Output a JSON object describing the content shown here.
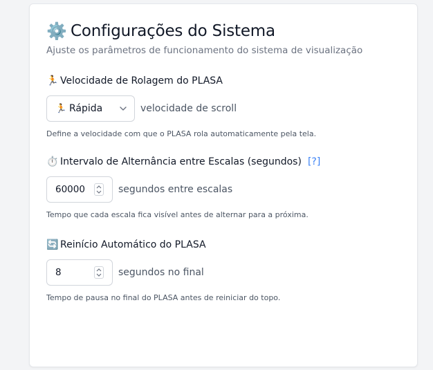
{
  "header": {
    "icon": "gear-icon",
    "icon_glyph": "⚙️",
    "title": "Configurações do Sistema",
    "subtitle": "Ajuste os parâmetros de funcionamento do sistema de visualização"
  },
  "scroll_speed": {
    "icon": "runner-icon",
    "icon_glyph": "🏃",
    "label": "Velocidade de Rolagem do PLASA",
    "selected_icon_glyph": "🏃",
    "selected_value": "Rápida",
    "suffix": "velocidade de scroll",
    "help": "Define a velocidade com que o PLASA rola automaticamente pela tela."
  },
  "scale_interval": {
    "icon": "stopwatch-icon",
    "icon_glyph": "⏱️",
    "label": "Intervalo de Alternância entre Escalas (segundos)",
    "help_link": "[?]",
    "value": "60000",
    "suffix": "segundos entre escalas",
    "help": "Tempo que cada escala fica visível antes de alternar para a próxima."
  },
  "auto_restart": {
    "icon": "refresh-icon",
    "icon_glyph": "🔄",
    "label": "Reinício Automático do PLASA",
    "value": "8",
    "suffix": "segundos no final",
    "help": "Tempo de pausa no final do PLASA antes de reiniciar do topo."
  }
}
